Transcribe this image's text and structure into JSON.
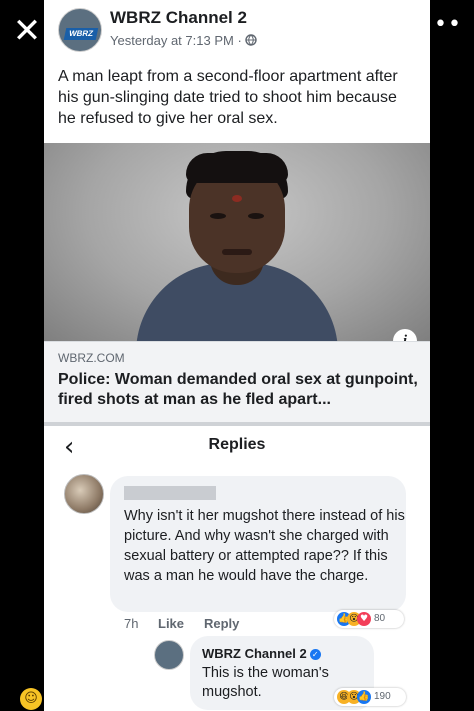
{
  "viewer": {
    "close_icon": "close-icon",
    "tag_icon": "tag-icon",
    "more_icon": "more-options-icon",
    "more_glyph": "•••"
  },
  "post": {
    "author": "WBRZ Channel 2",
    "avatar_logo_text": "WBRZ",
    "timestamp": "Yesterday at 7:13 PM",
    "privacy_icon": "globe-icon",
    "text": "A man leapt from a second-floor apartment after his gun-slinging date tried to shoot him because he refused to give her oral sex."
  },
  "link_preview": {
    "domain": "WBRZ.COM",
    "title": "Police: Woman demanded oral sex at gunpoint, fired shots at man as he fled apart..."
  },
  "replies": {
    "title": "Replies",
    "back_icon": "back-arrow-icon"
  },
  "comment": {
    "text": "Why isn't it her mugshot there instead of his picture. And why wasn't she charged with sexual battery or attempted rape?? If this was a man he would have the charge.",
    "time": "7h",
    "like_label": "Like",
    "reply_label": "Reply",
    "reaction_count": "80"
  },
  "page_reply": {
    "author": "WBRZ Channel 2",
    "text": "This is the woman's mugshot.",
    "reaction_count": "190"
  },
  "colors": {
    "facebook_blue": "#1877f2",
    "bubble_gray": "#f0f2f5"
  }
}
